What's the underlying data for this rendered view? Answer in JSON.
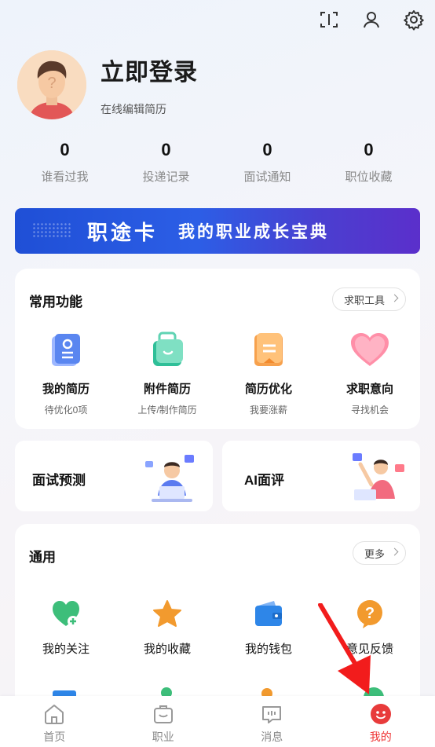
{
  "topbar": {
    "icons": [
      "scan-icon",
      "user-icon",
      "settings-icon"
    ]
  },
  "profile": {
    "title": "立即登录",
    "subtitle": "在线编辑简历"
  },
  "stats": [
    {
      "value": "0",
      "label": "谁看过我"
    },
    {
      "value": "0",
      "label": "投递记录"
    },
    {
      "value": "0",
      "label": "面试通知"
    },
    {
      "value": "0",
      "label": "职位收藏"
    }
  ],
  "banner": {
    "title": "职途卡",
    "slogan": "我的职业成长宝典"
  },
  "common": {
    "title": "常用功能",
    "tool_button": "求职工具",
    "items": [
      {
        "title": "我的简历",
        "sub": "待优化0项"
      },
      {
        "title": "附件简历",
        "sub": "上传/制作简历"
      },
      {
        "title": "简历优化",
        "sub": "我要涨薪"
      },
      {
        "title": "求职意向",
        "sub": "寻找机会"
      }
    ]
  },
  "cards": {
    "interview": "面试预测",
    "ai": "AI面评"
  },
  "general": {
    "title": "通用",
    "more": "更多",
    "items": [
      {
        "label": "我的关注"
      },
      {
        "label": "我的收藏"
      },
      {
        "label": "我的钱包"
      },
      {
        "label": "意见反馈"
      }
    ]
  },
  "tabs": [
    {
      "label": "首页"
    },
    {
      "label": "职业"
    },
    {
      "label": "消息"
    },
    {
      "label": "我的"
    }
  ],
  "colors": {
    "accent": "#e83b3b",
    "banner": "#2c5ee6"
  }
}
